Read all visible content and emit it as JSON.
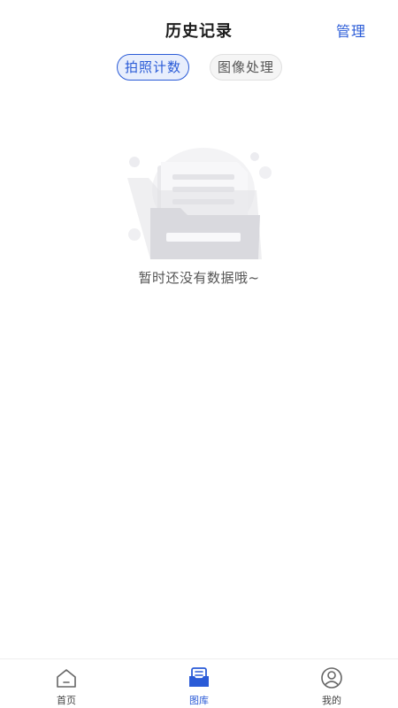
{
  "header": {
    "title": "历史记录",
    "manage_label": "管理"
  },
  "tabs": [
    {
      "label": "拍照计数",
      "active": true
    },
    {
      "label": "图像处理",
      "active": false
    }
  ],
  "empty": {
    "icon": "empty-folder-icon",
    "text": "暂时还没有数据哦~"
  },
  "tabbar": {
    "items": [
      {
        "label": "首页",
        "icon": "home-icon",
        "active": false
      },
      {
        "label": "图库",
        "icon": "gallery-icon",
        "active": true
      },
      {
        "label": "我的",
        "icon": "profile-icon",
        "active": false
      }
    ]
  },
  "colors": {
    "accent": "#2a5bd7",
    "tab_active_bg": "#e8eefc",
    "text_muted": "#555555"
  }
}
